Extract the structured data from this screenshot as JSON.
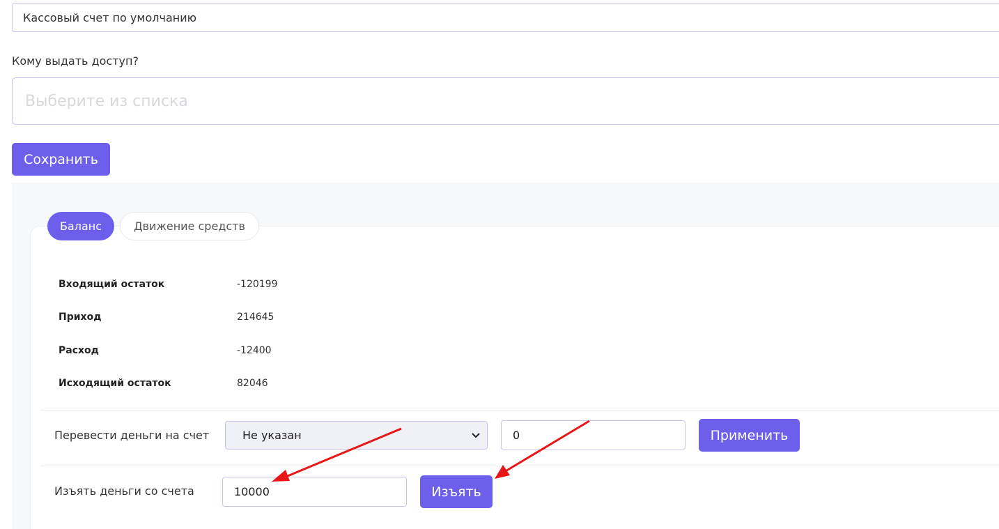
{
  "account": {
    "selected": "Кассовый счет по умолчанию"
  },
  "access": {
    "label": "Кому выдать доступ?",
    "placeholder": "Выберите из списка"
  },
  "save_label": "Сохранить",
  "tabs": [
    {
      "label": "Баланс",
      "active": true
    },
    {
      "label": "Движение средств",
      "active": false
    }
  ],
  "balance": [
    {
      "label": "Входящий остаток",
      "value": "-120199"
    },
    {
      "label": "Приход",
      "value": "214645"
    },
    {
      "label": "Расход",
      "value": "-12400"
    },
    {
      "label": "Исходящий остаток",
      "value": "82046"
    }
  ],
  "transfer": {
    "label": "Перевести деньги на счет",
    "selected": "Не указан",
    "amount": "0",
    "apply_label": "Применить"
  },
  "withdraw": {
    "label": "Изъять деньги со счета",
    "amount": "10000",
    "button_label": "Изъять"
  },
  "colors": {
    "accent": "#6c5fec",
    "annotation_arrow": "#e81616"
  }
}
